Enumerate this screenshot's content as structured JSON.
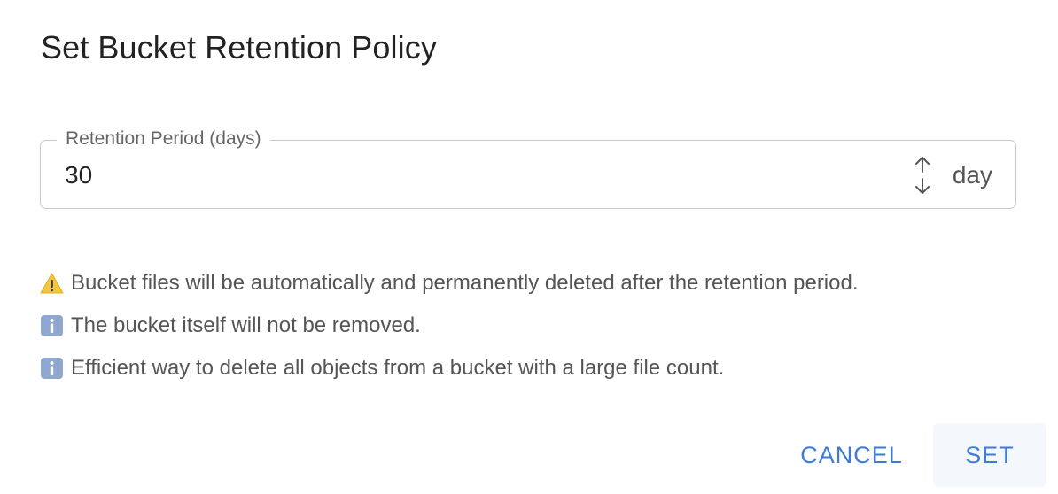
{
  "dialog": {
    "title": "Set Bucket Retention Policy",
    "field": {
      "label": "Retention Period (days)",
      "value": "30",
      "unit": "day"
    },
    "notes": [
      {
        "icon": "warning-icon",
        "text": "Bucket files will be automatically and permanently deleted after the retention period."
      },
      {
        "icon": "info-icon",
        "text": "The bucket itself will not be removed."
      },
      {
        "icon": "info-icon",
        "text": "Efficient way to delete all objects from a bucket with a large file count."
      }
    ],
    "buttons": {
      "cancel": "CANCEL",
      "set": "SET"
    }
  },
  "colors": {
    "accent": "#3e7ad6",
    "warning": "#f4c53d",
    "info": "#8ea8cf"
  }
}
